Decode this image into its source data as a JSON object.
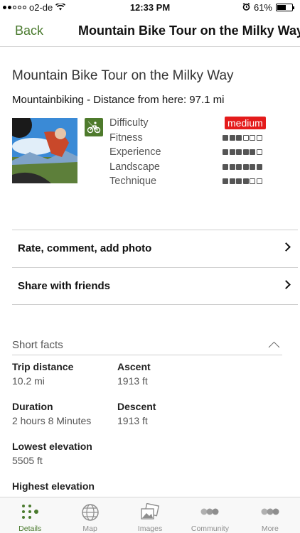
{
  "status_bar": {
    "carrier": "o2-de",
    "time": "12:33 PM",
    "battery": "61%",
    "signal_bars_filled": 2,
    "signal_bars_total": 5,
    "battery_level": 0.61
  },
  "nav": {
    "back_label": "Back",
    "title": "Mountain Bike Tour on the Milky Way"
  },
  "tour": {
    "title": "Mountain Bike Tour on the Milky Way",
    "subtitle": "Mountainbiking - Distance from here: 97.1 mi",
    "activity_icon": "mountain-bike-icon",
    "difficulty": {
      "label": "Difficulty",
      "value": "medium",
      "color": "#e41b1b"
    },
    "ratings": [
      {
        "label": "Fitness",
        "filled": 3,
        "total": 6
      },
      {
        "label": "Experience",
        "filled": 5,
        "total": 6
      },
      {
        "label": "Landscape",
        "filled": 6,
        "total": 6
      },
      {
        "label": "Technique",
        "filled": 4,
        "total": 6
      }
    ]
  },
  "actions": {
    "rate_label": "Rate, comment, add photo",
    "share_label": "Share with friends"
  },
  "short_facts": {
    "title": "Short facts",
    "trip_distance": {
      "label": "Trip distance",
      "value": "10.2 mi"
    },
    "ascent": {
      "label": "Ascent",
      "value": "1913 ft"
    },
    "duration": {
      "label": "Duration",
      "value": "2 hours 8 Minutes"
    },
    "descent": {
      "label": "Descent",
      "value": "1913 ft"
    },
    "lowest_elevation": {
      "label": "Lowest elevation",
      "value": "5505 ft"
    },
    "highest_elevation": {
      "label": "Highest elevation",
      "value": ""
    }
  },
  "tabs": [
    {
      "label": "Details",
      "icon": "details-icon",
      "active": true
    },
    {
      "label": "Map",
      "icon": "globe-icon",
      "active": false
    },
    {
      "label": "Images",
      "icon": "images-icon",
      "active": false
    },
    {
      "label": "Community",
      "icon": "community-icon",
      "active": false
    },
    {
      "label": "More",
      "icon": "more-icon",
      "active": false
    }
  ],
  "colors": {
    "accent": "#4a7a2e",
    "difficulty_badge": "#e41b1b"
  }
}
